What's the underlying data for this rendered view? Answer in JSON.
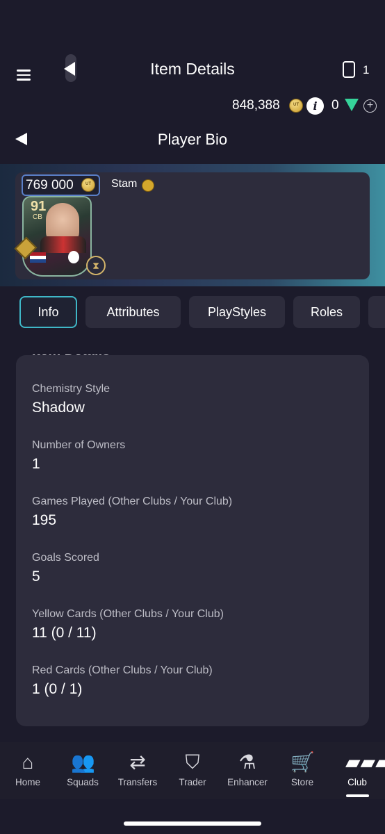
{
  "header": {
    "title": "Item Details",
    "card_count": "1"
  },
  "currency": {
    "coins": "848,388",
    "points": "0"
  },
  "sub_header": {
    "title": "Player Bio"
  },
  "player": {
    "price": "769 000",
    "name": "Stam",
    "rating": "91",
    "position": "CB"
  },
  "tabs": [
    {
      "label": "Info",
      "active": true
    },
    {
      "label": "Attributes",
      "active": false
    },
    {
      "label": "PlayStyles",
      "active": false
    },
    {
      "label": "Roles",
      "active": false
    }
  ],
  "details": {
    "heading": "Item Details",
    "rows": [
      {
        "label": "Chemistry Style",
        "value": "Shadow"
      },
      {
        "label": "Number of Owners",
        "value": "1"
      },
      {
        "label": "Games Played (Other Clubs / Your Club)",
        "value": "195"
      },
      {
        "label": "Goals Scored",
        "value": "5"
      },
      {
        "label": "Yellow Cards (Other Clubs / Your Club)",
        "value": "11 (0 / 11)"
      },
      {
        "label": "Red Cards (Other Clubs / Your Club)",
        "value": "1 (0 / 1)"
      }
    ]
  },
  "nav": [
    {
      "label": "Home",
      "icon": "home-icon"
    },
    {
      "label": "Squads",
      "icon": "squads-icon"
    },
    {
      "label": "Transfers",
      "icon": "transfers-icon"
    },
    {
      "label": "Trader",
      "icon": "trader-icon"
    },
    {
      "label": "Enhancer",
      "icon": "enhancer-icon"
    },
    {
      "label": "Store",
      "icon": "store-icon"
    },
    {
      "label": "Club",
      "icon": "club-icon",
      "active": true
    }
  ],
  "colors": {
    "background": "#1c1b2b",
    "panel": "#2d2c3c",
    "accent": "#3fb7c7"
  }
}
